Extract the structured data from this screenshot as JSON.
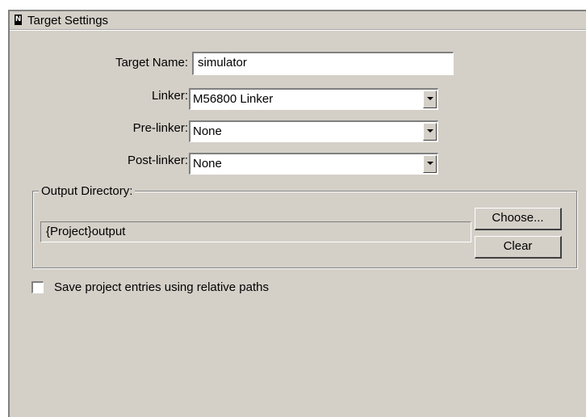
{
  "window": {
    "title": "Target Settings",
    "icon": "app-icon"
  },
  "form": {
    "target_name": {
      "label": "Target Name:",
      "value": "simulator"
    },
    "linker": {
      "label": "Linker:",
      "value": "M56800 Linker"
    },
    "pre_linker": {
      "label": "Pre-linker:",
      "value": "None"
    },
    "post_linker": {
      "label": "Post-linker:",
      "value": "None"
    }
  },
  "output_directory": {
    "legend": "Output Directory:",
    "value": "{Project}output",
    "choose_label": "Choose...",
    "clear_label": "Clear"
  },
  "options": {
    "relative_paths_label": "Save project entries using relative paths",
    "relative_paths_checked": false
  }
}
